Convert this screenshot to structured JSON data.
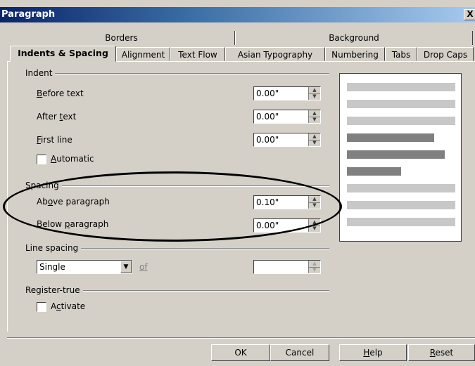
{
  "window": {
    "title": "Paragraph",
    "close": "X"
  },
  "tabs_back": [
    "Borders",
    "Background"
  ],
  "tabs_front": [
    "Indents & Spacing",
    "Alignment",
    "Text Flow",
    "Asian Typography",
    "Numbering",
    "Tabs",
    "Drop Caps"
  ],
  "indent": {
    "group": "Indent",
    "before_text": {
      "label": "Before text",
      "value": "0.00\""
    },
    "after_text": {
      "label": "After text",
      "value": "0.00\""
    },
    "first_line": {
      "label": "First line",
      "value": "0.00\""
    },
    "automatic": {
      "label": "Automatic",
      "checked": false
    }
  },
  "spacing": {
    "group": "Spacing",
    "above": {
      "label": "Above paragraph",
      "value": "0.10\""
    },
    "below": {
      "label": "Below paragraph",
      "value": "0.00\""
    }
  },
  "line_spacing": {
    "group": "Line spacing",
    "selected": "Single",
    "of_label": "of",
    "value": ""
  },
  "register_true": {
    "group": "Register-true",
    "activate": {
      "label": "Activate",
      "checked": false
    }
  },
  "buttons": {
    "ok": "OK",
    "cancel": "Cancel",
    "help": "Help",
    "reset": "Reset"
  },
  "colors": {
    "preview_light": "#c8c8c8",
    "preview_dark": "#808080",
    "title_start": "#0a246a",
    "title_end": "#a6caf0"
  }
}
